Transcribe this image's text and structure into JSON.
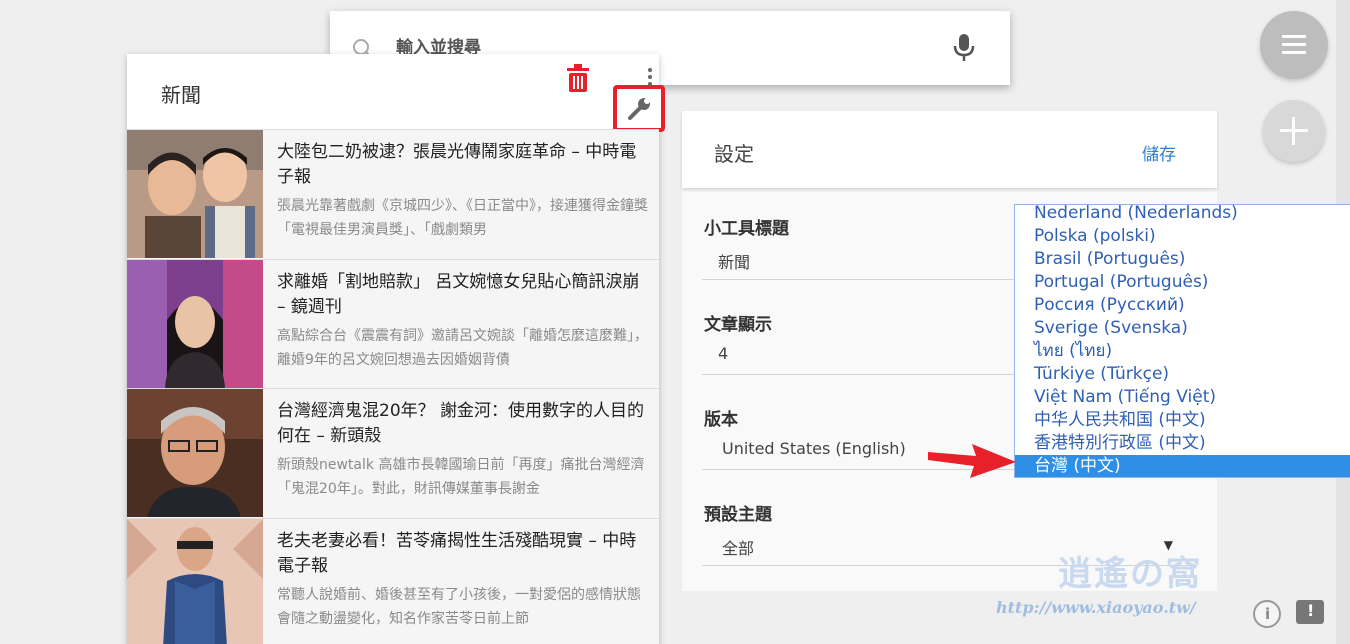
{
  "search": {
    "placeholder": "輸入並搜尋"
  },
  "news_widget": {
    "title": "新聞",
    "items": [
      {
        "headline": "大陸包二奶被逮？張晨光傳鬧家庭革命 – 中時電子報",
        "snippet": "張晨光靠著戲劇《京城四少》、《日正當中》，接連獲得金鐘獎「電視最佳男演員獎」、「戲劇類男"
      },
      {
        "headline": "求離婚「割地賠款」 呂文婉憶女兒貼心簡訊淚崩 – 鏡週刊",
        "snippet": "高點綜合台《震震有詞》邀請呂文婉談「離婚怎麼這麼難」，離婚9年的呂文婉回想過去因婚姻背債"
      },
      {
        "headline": "台灣經濟鬼混20年？ 謝金河：使用數字的人目的何在 – 新頭殼",
        "snippet": "新頭殼newtalk 高雄市長韓國瑜日前「再度」痛批台灣經濟「鬼混20年」。對此，財訊傳媒董事長謝金"
      },
      {
        "headline": "老夫老妻必看！苦苓痛揭性生活殘酷現實 – 中時電子報",
        "snippet": "常聽人說婚前、婚後甚至有了小孩後，一對愛侶的感情狀態會隨之動盪變化，知名作家苦苓日前上節"
      }
    ]
  },
  "settings": {
    "title": "設定",
    "save_label": "儲存",
    "widget_title_label": "小工具標題",
    "widget_title_value": "新聞",
    "articles_label": "文章顯示",
    "articles_value": "4",
    "edition_label": "版本",
    "edition_value": "United States (English)",
    "topic_label": "預設主題",
    "topic_value": "全部"
  },
  "edition_options": [
    "Nederland (Nederlands)",
    "Polska (polski)",
    "Brasil (Português)",
    "Portugal (Português)",
    "Россия (Русский)",
    "Sverige (Svenska)",
    "ไทย (ไทย)",
    "Türkiye (Türkçe)",
    "Việt Nam (Tiếng Việt)",
    "中华人民共和国 (中文)",
    "香港特別行政區 (中文)",
    "台灣 (中文)"
  ],
  "edition_selected": "台灣 (中文)",
  "watermark": {
    "logo": "逍遙の窩",
    "url": "http://www.xiaoyao.tw/"
  },
  "colors": {
    "accent": "#2a7fd8",
    "highlight": "#e8202a",
    "selected": "#2f8ee6"
  },
  "icons": [
    "search-icon",
    "mic-icon",
    "menu-icon",
    "add-icon",
    "trash-icon",
    "more-icon",
    "wrench-icon",
    "info-icon",
    "feedback-icon"
  ]
}
